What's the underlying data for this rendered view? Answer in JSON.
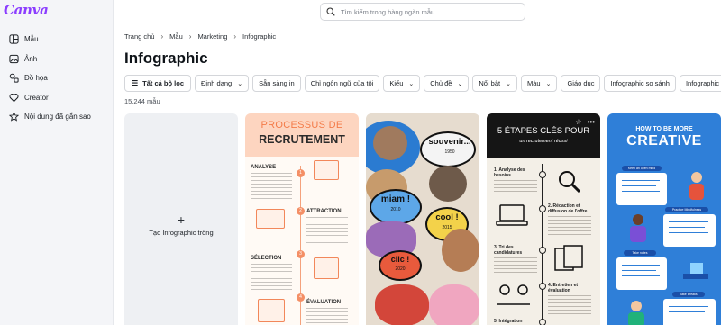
{
  "brand": {
    "logo_text": "Canva",
    "accent": "#8b3dff"
  },
  "sidebar": {
    "items": [
      {
        "label": "Mẫu",
        "icon": "template-icon"
      },
      {
        "label": "Ảnh",
        "icon": "image-icon"
      },
      {
        "label": "Đồ họa",
        "icon": "shapes-icon"
      },
      {
        "label": "Creator",
        "icon": "heart-icon"
      },
      {
        "label": "Nội dung đã gắn sao",
        "icon": "star-icon"
      }
    ]
  },
  "search": {
    "placeholder": "Tìm kiếm trong hàng ngàn mẫu"
  },
  "breadcrumb": [
    "Trang chủ",
    "Mẫu",
    "Marketing",
    "Infographic"
  ],
  "page": {
    "title": "Infographic",
    "count": "15.244 mẫu"
  },
  "filters": {
    "all_filters": "Tất cả bộ lọc",
    "chips": [
      {
        "label": "Định dạng",
        "dropdown": true
      },
      {
        "label": "Sẵn sàng in",
        "dropdown": false
      },
      {
        "label": "Chỉ ngôn ngữ của tôi",
        "dropdown": false
      },
      {
        "label": "Kiểu",
        "dropdown": true
      },
      {
        "label": "Chủ đề",
        "dropdown": true
      },
      {
        "label": "Nổi bật",
        "dropdown": true
      },
      {
        "label": "Màu",
        "dropdown": true
      },
      {
        "label": "Giáo dục",
        "dropdown": false
      },
      {
        "label": "Infographic so sánh",
        "dropdown": false
      },
      {
        "label": "Infographic dữ liệu",
        "dropdown": false
      }
    ]
  },
  "blank_card": {
    "plus": "+",
    "label": "Tạo Infographic trống"
  },
  "template_recrutement": {
    "title_line1": "PROCESSUS DE",
    "title_line2": "RECRUTEMENT",
    "sections": [
      "ANALYSE",
      "ATTRACTION",
      "SÉLECTION",
      "ÉVALUATION"
    ],
    "steps": [
      "1",
      "2",
      "3",
      "4"
    ]
  },
  "template_souvenir": {
    "tags": [
      "souvenir...",
      "1950",
      "miam !",
      "2010",
      "cool !",
      "2015",
      "clic !",
      "2020"
    ]
  },
  "template_etapes": {
    "title": "5 ÉTAPES CLÉS POUR",
    "subtitle": "un recrutement réussi",
    "steps": [
      "1. Analyse des besoins",
      "2. Rédaction et diffusion de l'offre",
      "3. Tri des candidatures",
      "4. Entretien et évaluation",
      "5. Intégration"
    ],
    "star_icon": "☆",
    "more_icon": "•••"
  },
  "template_creative": {
    "title_small": "HOW TO BE MORE",
    "title_big": "CREATIVE",
    "pills": [
      "Keep an open mind",
      "Practice Mindfulness",
      "Take notes",
      "Take Breaks"
    ]
  }
}
